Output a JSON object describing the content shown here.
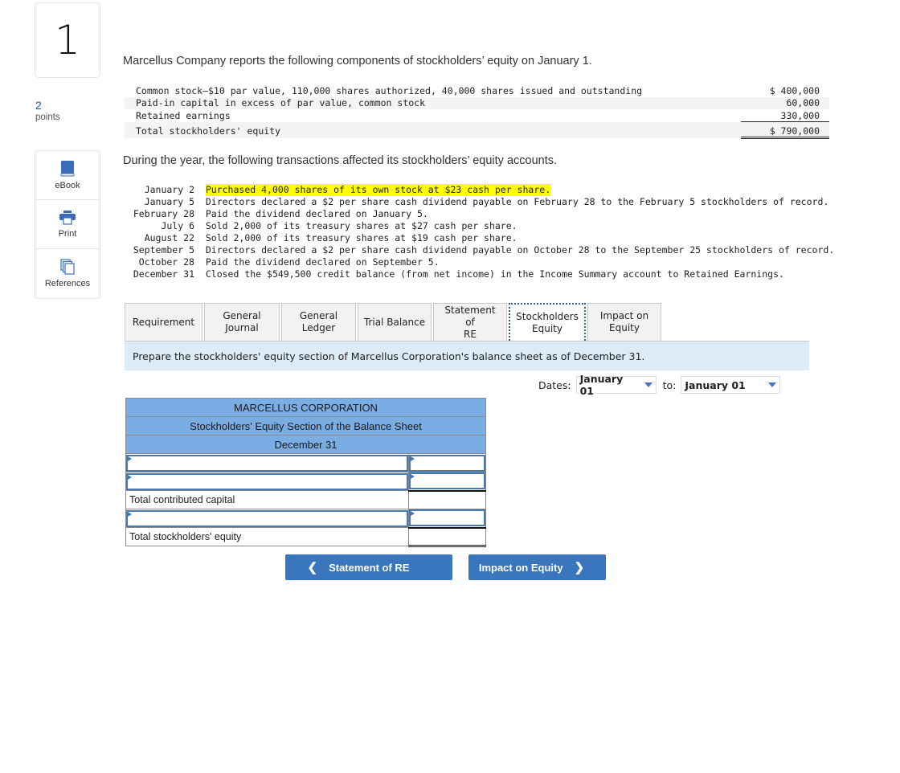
{
  "question": {
    "number": "1",
    "points_value": "2",
    "points_label": "points"
  },
  "tools": [
    {
      "label": "eBook",
      "icon": "book-icon"
    },
    {
      "label": "Print",
      "icon": "printer-icon"
    },
    {
      "label": "References",
      "icon": "copy-documents-icon"
    }
  ],
  "intro": "Marcellus Company reports the following components of stockholders’ equity on January 1.",
  "equity_components": [
    {
      "label": "Common stock—$10 par value, 110,000 shares authorized, 40,000 shares issued and outstanding",
      "amount": "$ 400,000"
    },
    {
      "label": "Paid-in capital in excess of par value, common stock",
      "amount": "60,000"
    },
    {
      "label": "Retained earnings",
      "amount": "330,000"
    },
    {
      "label": "Total stockholders' equity",
      "amount": "$ 790,000"
    }
  ],
  "during_text": "During the year, the following transactions affected its stockholders’ equity accounts.",
  "transactions": [
    {
      "date": "January 2",
      "text": "Purchased 4,000 shares of its own stock at $23 cash per share.",
      "highlight": true
    },
    {
      "date": "January 5",
      "text": "Directors declared a $2 per share cash dividend payable on February 28 to the February 5 stockholders of record."
    },
    {
      "date": "February 28",
      "text": "Paid the dividend declared on January 5."
    },
    {
      "date": "July 6",
      "text": "Sold 2,000 of its treasury shares at $27 cash per share."
    },
    {
      "date": "August 22",
      "text": "Sold 2,000 of its treasury shares at $19 cash per share."
    },
    {
      "date": "September 5",
      "text": "Directors declared a $2 per share cash dividend payable on October 28 to the September 25 stockholders of record."
    },
    {
      "date": "October 28",
      "text": "Paid the dividend declared on September 5."
    },
    {
      "date": "December 31",
      "text": "Closed the $549,500 credit balance (from net income) in the Income Summary account to Retained Earnings."
    }
  ],
  "tabs": [
    {
      "line1": "Requirement",
      "line2": ""
    },
    {
      "line1": "General",
      "line2": "Journal"
    },
    {
      "line1": "General",
      "line2": "Ledger"
    },
    {
      "line1": "Trial Balance",
      "line2": ""
    },
    {
      "line1": "Statement of",
      "line2": "RE"
    },
    {
      "line1": "Stockholders",
      "line2": "Equity",
      "active": true
    },
    {
      "line1": "Impact on",
      "line2": "Equity"
    }
  ],
  "instruction": "Prepare the stockholders' equity section of Marcellus Corporation's balance sheet as of December 31.",
  "dates": {
    "label": "Dates:",
    "from": "January 01",
    "to_label": "to:",
    "to": "January 01"
  },
  "worksheet": {
    "title": "MARCELLUS CORPORATION",
    "subtitle": "Stockholders' Equity Section of the Balance Sheet",
    "date": "December 31",
    "total_contributed_label": "Total contributed capital",
    "total_equity_label": "Total stockholders' equity",
    "inputs": {
      "row1_label": "",
      "row1_value": "",
      "row2_label": "",
      "row2_value": "",
      "row3_label": "",
      "row3_value": ""
    }
  },
  "nav": {
    "prev_label": "Statement of RE",
    "next_label": "Impact on Equity"
  },
  "colors": {
    "accent": "#3a76bd",
    "header_blue": "#7aade4",
    "instruction_bg": "#dbecf8",
    "highlight": "#ffff00"
  }
}
